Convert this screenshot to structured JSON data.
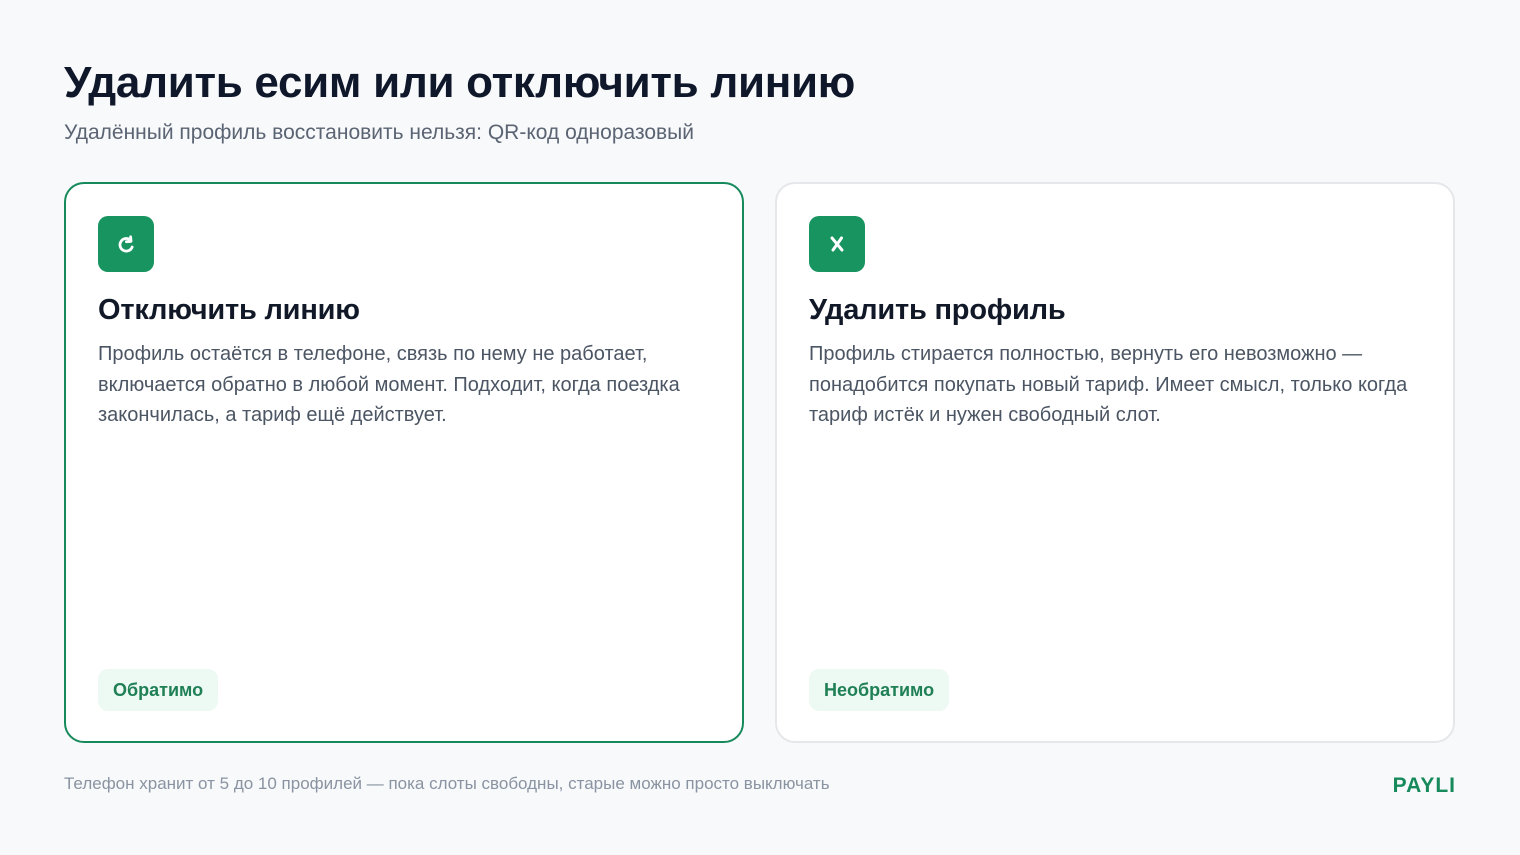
{
  "header": {
    "title": "Удалить есим или отключить линию",
    "subtitle": "Удалённый профиль восстановить нельзя: QR-код одноразовый"
  },
  "cards": [
    {
      "title": "Отключить линию",
      "body": "Профиль остаётся в телефоне, связь по нему не работает, включается обратно в любой момент. Подходит, когда поездка закончилась, а тариф ещё действует.",
      "badge": "Обратимо",
      "icon": "undo-icon",
      "selected": true
    },
    {
      "title": "Удалить профиль",
      "body": "Профиль стирается полностью, вернуть его невозможно — понадобится покупать новый тариф. Имеет смысл, только когда тариф истёк и нужен свободный слот.",
      "badge": "Необратимо",
      "icon": "close-icon",
      "selected": false
    }
  ],
  "footer": {
    "note": "Телефон хранит от 5 до 10 профилей — пока слоты свободны, старые можно просто выключать",
    "brand": "PAYLI"
  },
  "colors": {
    "background": "#f7f9fb",
    "accent": "#178a5b",
    "icon_background": "#17945f",
    "badge_background": "#edf9f3",
    "badge_text": "#1f7f55"
  }
}
